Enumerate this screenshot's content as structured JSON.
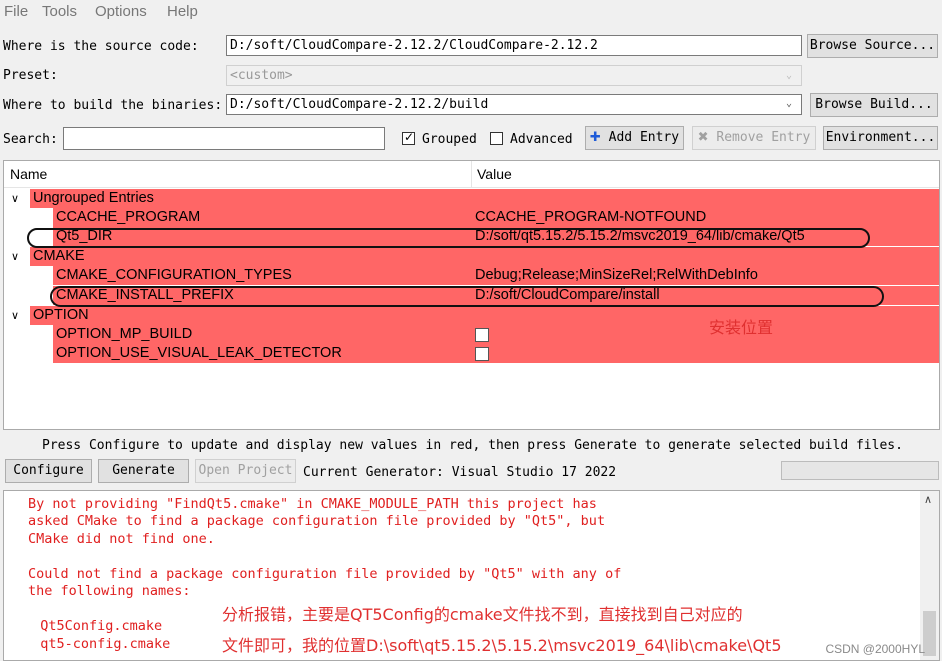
{
  "menu": [
    "File",
    "Tools",
    "Options",
    "Help"
  ],
  "source": {
    "label": "Where is the source code:",
    "value": "D:/soft/CloudCompare-2.12.2/CloudCompare-2.12.2",
    "browse": "Browse Source..."
  },
  "preset": {
    "label": "Preset:",
    "value": "<custom>"
  },
  "build": {
    "label": "Where to build the binaries:",
    "value": "D:/soft/CloudCompare-2.12.2/build",
    "browse": "Browse Build..."
  },
  "search": {
    "label": "Search:",
    "value": ""
  },
  "toolbar": {
    "grouped": "Grouped",
    "grouped_checked": true,
    "advanced": "Advanced",
    "advanced_checked": false,
    "add_entry": "Add Entry",
    "remove_entry": "Remove Entry",
    "environment": "Environment..."
  },
  "tree": {
    "headers": [
      "Name",
      "Value"
    ],
    "groups": [
      {
        "name": "Ungrouped Entries",
        "entries": [
          {
            "name": "CCACHE_PROGRAM",
            "value": "CCACHE_PROGRAM-NOTFOUND"
          },
          {
            "name": "Qt5_DIR",
            "value": "D:/soft/qt5.15.2/5.15.2/msvc2019_64/lib/cmake/Qt5"
          }
        ]
      },
      {
        "name": "CMAKE",
        "entries": [
          {
            "name": "CMAKE_CONFIGURATION_TYPES",
            "value": "Debug;Release;MinSizeRel;RelWithDebInfo"
          },
          {
            "name": "CMAKE_INSTALL_PREFIX",
            "value": "D:/soft/CloudCompare/install"
          }
        ]
      },
      {
        "name": "OPTION",
        "entries": [
          {
            "name": "OPTION_MP_BUILD",
            "value": ""
          },
          {
            "name": "OPTION_USE_VISUAL_LEAK_DETECTOR",
            "value": ""
          }
        ]
      }
    ]
  },
  "annotation_install": "安装位置",
  "hint": "Press Configure to update and display new values in red, then press Generate to generate selected build files.",
  "actions": {
    "configure": "Configure",
    "generate": "Generate",
    "open_project": "Open Project",
    "generator": "Current Generator: Visual Studio 17 2022"
  },
  "log": [
    "By not providing \"FindQt5.cmake\" in CMAKE_MODULE_PATH this project has",
    "asked CMake to find a package configuration file provided by \"Qt5\", but",
    "CMake did not find one.",
    "",
    "Could not find a package configuration file provided by \"Qt5\" with any of",
    "the following names:",
    "",
    "  Qt5Config.cmake",
    "  qt5-config.cmake"
  ],
  "annotation_log_1": "分析报错，主要是QT5Config的cmake文件找不到，直接找到自己对应的",
  "annotation_log_2": "文件即可，我的位置D:\\soft\\qt5.15.2\\5.15.2\\msvc2019_64\\lib\\cmake\\Qt5",
  "watermark": "CSDN @2000HYL",
  "colors": {
    "changed_row": "#ff6666",
    "annotation": "#e03030",
    "log_text": "#e02020"
  }
}
